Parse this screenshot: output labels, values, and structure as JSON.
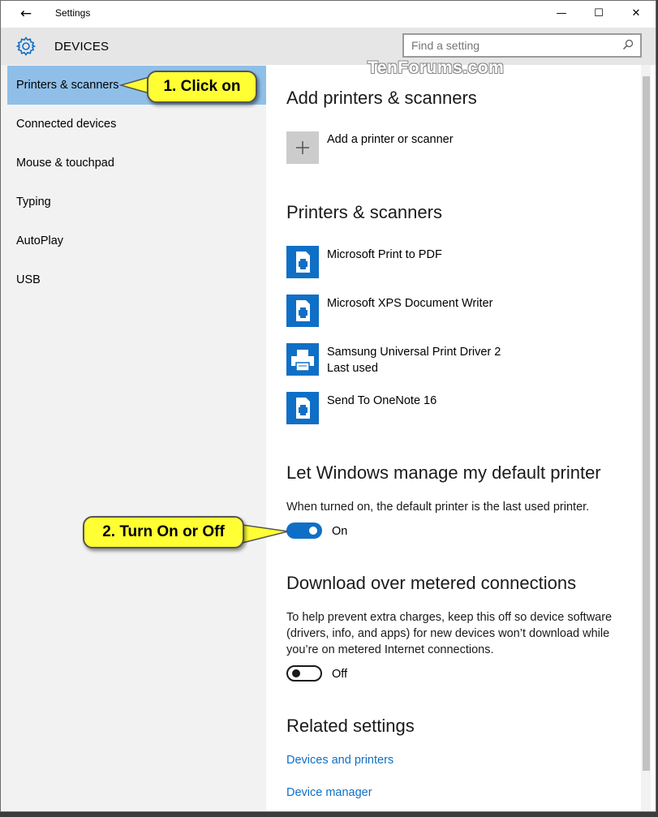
{
  "window": {
    "title": "Settings",
    "back_icon": "back-arrow-icon",
    "minimize_glyph": "—",
    "maximize_glyph": "☐",
    "close_glyph": "✕"
  },
  "header": {
    "section": "DEVICES",
    "icon": "gear-icon",
    "search_placeholder": "Find a setting"
  },
  "sidebar": {
    "items": [
      {
        "label": "Printers & scanners",
        "selected": true
      },
      {
        "label": "Connected devices"
      },
      {
        "label": "Mouse & touchpad"
      },
      {
        "label": "Typing"
      },
      {
        "label": "AutoPlay"
      },
      {
        "label": "USB"
      }
    ]
  },
  "main": {
    "add_section": {
      "title": "Add printers & scanners",
      "add_label": "Add a printer or scanner"
    },
    "printers_section": {
      "title": "Printers & scanners",
      "printers": [
        {
          "name": "Microsoft Print to PDF",
          "icon": "document-printer-icon"
        },
        {
          "name": "Microsoft XPS Document Writer",
          "icon": "document-printer-icon"
        },
        {
          "name": "Samsung Universal Print Driver 2",
          "status": "Last used",
          "icon": "printer-icon"
        },
        {
          "name": "Send To OneNote 16",
          "icon": "document-printer-icon"
        }
      ]
    },
    "default_printer": {
      "title": "Let Windows manage my default printer",
      "description": "When turned on, the default printer is the last used printer.",
      "toggle_state": "On"
    },
    "metered": {
      "title": "Download over metered connections",
      "description": "To help prevent extra charges, keep this off so device software (drivers, info, and apps) for new devices won’t download while you’re on metered Internet connections.",
      "toggle_state": "Off"
    },
    "related": {
      "title": "Related settings",
      "links": [
        "Devices and printers",
        "Device manager"
      ]
    }
  },
  "annotations": {
    "callout_1": "1. Click on",
    "callout_2": "2. Turn On or Off",
    "watermark": "TenForums.com"
  },
  "colors": {
    "accent": "#0f6fc6",
    "selected_nav": "#8fbfe8",
    "sidebar_bg": "#f2f2f2",
    "header_bg": "#e6e6e6",
    "callout": "#ffff33"
  }
}
